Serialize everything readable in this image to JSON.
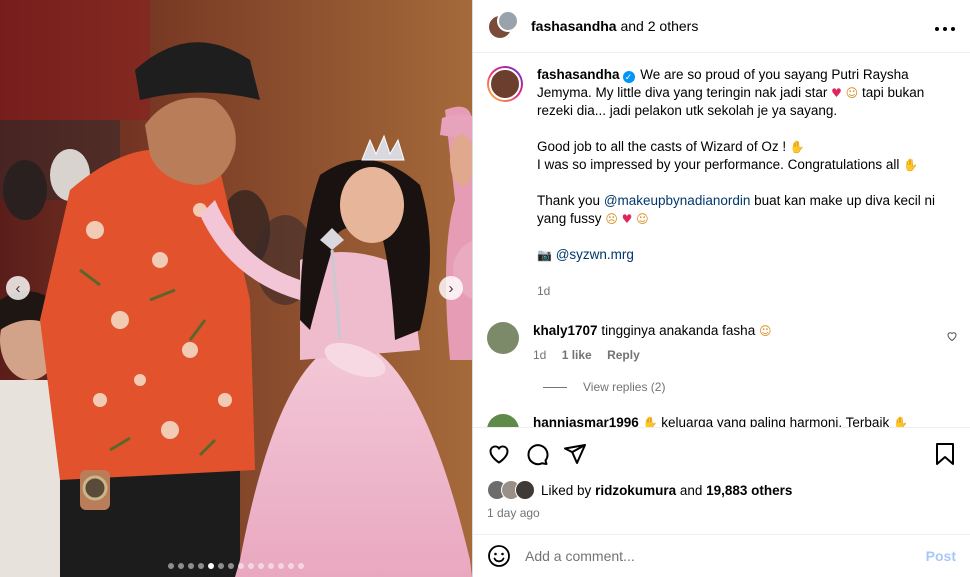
{
  "post": {
    "header": {
      "username": "fashasandha",
      "and_others": "and 2 others",
      "more_icon": "ellipsis-icon"
    },
    "caption": {
      "username": "fashasandha",
      "paragraphs": [
        "We are so proud of you sayang Putri Raysha Jemyma. My little diva yang teringin nak jadi star",
        "tapi bukan rezeki dia... jadi pelakon utk sekolah je ya sayang.",
        "Good job to all the casts of Wizard of Oz !",
        "I was so impressed by your performance. Congratulations all",
        "Thank you",
        "@makeupbynadianordin",
        "buat kan make up diva kecil ni yang fussy",
        "@syzwn.mrg"
      ],
      "timestamp": "1d"
    },
    "comments": [
      {
        "username": "khaly1707",
        "text": "tingginya anakanda fasha",
        "time": "1d",
        "likes": "1 like",
        "reply": "Reply",
        "view_replies": "View replies (2)"
      },
      {
        "username": "hanniasmar1996",
        "text": "keluarga yang paling harmoni. Terbaik"
      }
    ],
    "liked_by_prefix": "Liked by",
    "liked_by_user": "ridzokumura",
    "liked_by_and": "and",
    "liked_by_others": "19,883 others",
    "date": "1 day ago",
    "add_comment_placeholder": "Add a comment...",
    "post_label": "Post"
  },
  "colors": {
    "link": "#00376b",
    "verified": "#0095f6",
    "post_button_disabled": "#a8c7fa",
    "meta_gray": "#737373"
  },
  "carousel": {
    "dots": 14,
    "active_index": 4
  }
}
